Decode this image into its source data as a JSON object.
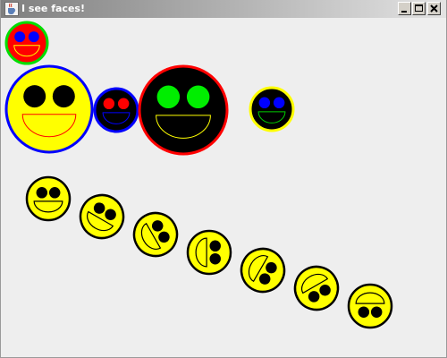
{
  "window": {
    "title": "I see faces!",
    "icon": "java-cup-icon",
    "controls": [
      {
        "name": "minimize-button",
        "icon": "minimize-icon"
      },
      {
        "name": "maximize-button",
        "icon": "maximize-icon"
      },
      {
        "name": "close-button",
        "icon": "close-icon"
      }
    ]
  },
  "colors": {
    "canvas_background": "#eeeeee",
    "title_gradient": [
      "#7f7f7f",
      "#e3e3e3"
    ],
    "title_text": "#ffffff",
    "button_face": "#d4d0c8"
  },
  "faces": [
    {
      "name": "face-red-small",
      "face": "#ff0000",
      "outline": "#00dd00",
      "eyes": "#0000ff",
      "mouth": "#ffff00",
      "mouth_style": "half"
    },
    {
      "name": "face-yellow-large",
      "face": "#ffff00",
      "outline": "#0000ff",
      "eyes": "#000000",
      "mouth": "#ff0000",
      "mouth_style": "half"
    },
    {
      "name": "face-black-redeyes",
      "face": "#000000",
      "outline": "#0000ff",
      "eyes": "#ff0000",
      "mouth": "#0000ff",
      "mouth_style": "half"
    },
    {
      "name": "face-black-large",
      "face": "#000000",
      "outline": "#ff0000",
      "eyes": "#00ee00",
      "mouth": "#ffff00",
      "mouth_style": "half"
    },
    {
      "name": "face-black-blueeyes",
      "face": "#000000",
      "outline": "#ffff00",
      "eyes": "#0000ff",
      "mouth": "#00cc00",
      "mouth_style": "half"
    }
  ],
  "rotating_faces": {
    "face": "#ffff00",
    "outline": "#000000",
    "eyes": "#000000",
    "mouth": "#000000",
    "rotations_deg": [
      0,
      30,
      60,
      90,
      120,
      150,
      180
    ]
  }
}
